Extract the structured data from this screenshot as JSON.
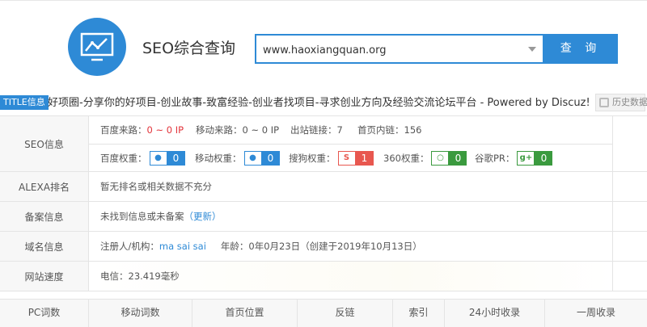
{
  "header": {
    "title": "SEO综合查询",
    "search_value": "www.haoxiangquan.org",
    "search_button": "查 询"
  },
  "title_row": {
    "badge": "TITLE信息",
    "text": "好项圈-分享你的好项目-创业故事-致富经验-创业者找项目-寻求创业方向及经验交流论坛平台 - Powered by Discuz!",
    "history_button": "历史数据"
  },
  "seo": {
    "label": "SEO信息",
    "baidu_traffic_label": "百度来路：",
    "baidu_traffic_value": "0 ~ 0 IP",
    "mobile_traffic_label": "移动来路：",
    "mobile_traffic_value": "0 ~ 0 IP",
    "outlinks_label": "出站链接：",
    "outlinks_value": "7",
    "inlinks_label": "首页内链：",
    "inlinks_value": "156",
    "weights": [
      {
        "label": "百度权重：",
        "icon": "baidu-paw-icon",
        "value": "0",
        "color": "#2e8ad6"
      },
      {
        "label": "移动权重：",
        "icon": "baidu-paw-icon",
        "value": "0",
        "color": "#2e8ad6"
      },
      {
        "label": "搜狗权重：",
        "icon": "sogou-icon",
        "value": "1",
        "color": "#e8574f"
      },
      {
        "label": "360权重：",
        "icon": "360-icon",
        "value": "0",
        "color": "#3a9a3e"
      },
      {
        "label": "谷歌PR：",
        "icon": "google-plus-icon",
        "value": "0",
        "color": "#3a9a3e"
      }
    ]
  },
  "alexa": {
    "label": "ALEXA排名",
    "value": "暂无排名或相关数据不充分"
  },
  "beian": {
    "label": "备案信息",
    "value": "未找到信息或未备案",
    "open_paren": "（",
    "link": "更新",
    "close_paren": "）"
  },
  "domain": {
    "label": "域名信息",
    "registrant_label": "注册人/机构：",
    "registrant_value": "ma sai sai",
    "age_label": "年龄：",
    "age_value": "0年0月23日",
    "created_text": "（创建于2019年10月13日）"
  },
  "speed": {
    "label": "网站速度",
    "value": "电信：23.419毫秒"
  },
  "bottom_tabs": [
    "PC词数",
    "移动词数",
    "首页位置",
    "反链",
    "索引",
    "24小时收录",
    "一周收录"
  ]
}
